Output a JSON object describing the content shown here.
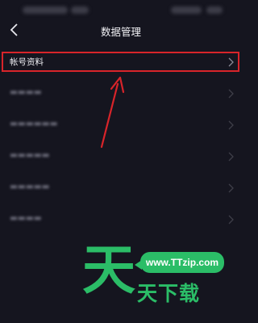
{
  "header": {
    "title": "数据管理",
    "back_icon": "chevron-left-icon"
  },
  "list": {
    "items": [
      {
        "label": "帐号资料",
        "chevron": "chevron-right-icon"
      }
    ]
  },
  "annotation": {
    "highlight_color": "#d8242a"
  },
  "watermark": {
    "big_char": "天",
    "url": "www.TTzip.com",
    "subtitle": "天下载",
    "color": "#2bbd67"
  }
}
